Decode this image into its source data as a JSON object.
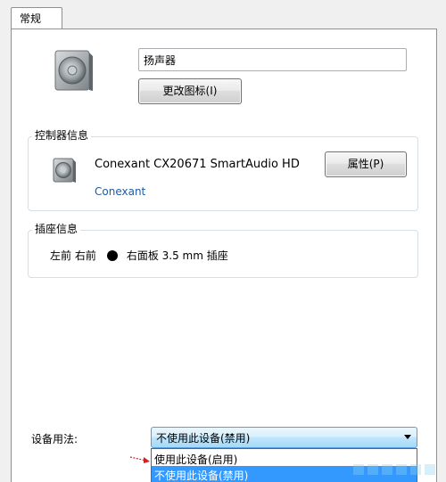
{
  "tabs": [
    {
      "label": "常规"
    }
  ],
  "device": {
    "name": "扬声器",
    "change_icon_label": "更改图标(I)"
  },
  "controller": {
    "title": "控制器信息",
    "device_name": "Conexant CX20671 SmartAudio HD",
    "vendor": "Conexant",
    "properties_label": "属性(P)"
  },
  "jack": {
    "title": "插座信息",
    "position": "左前 右前",
    "description": "右面板 3.5 mm 插座",
    "dot_color": "#000000"
  },
  "usage": {
    "label": "设备用法:",
    "selected": "不使用此设备(禁用)",
    "options": [
      "使用此设备(启用)",
      "不使用此设备(禁用)"
    ],
    "highlighted_index": 1
  },
  "colors": {
    "selection_highlight": "#3399ff",
    "link": "#1e5aa8",
    "annotation_arrow": "#d62020"
  }
}
